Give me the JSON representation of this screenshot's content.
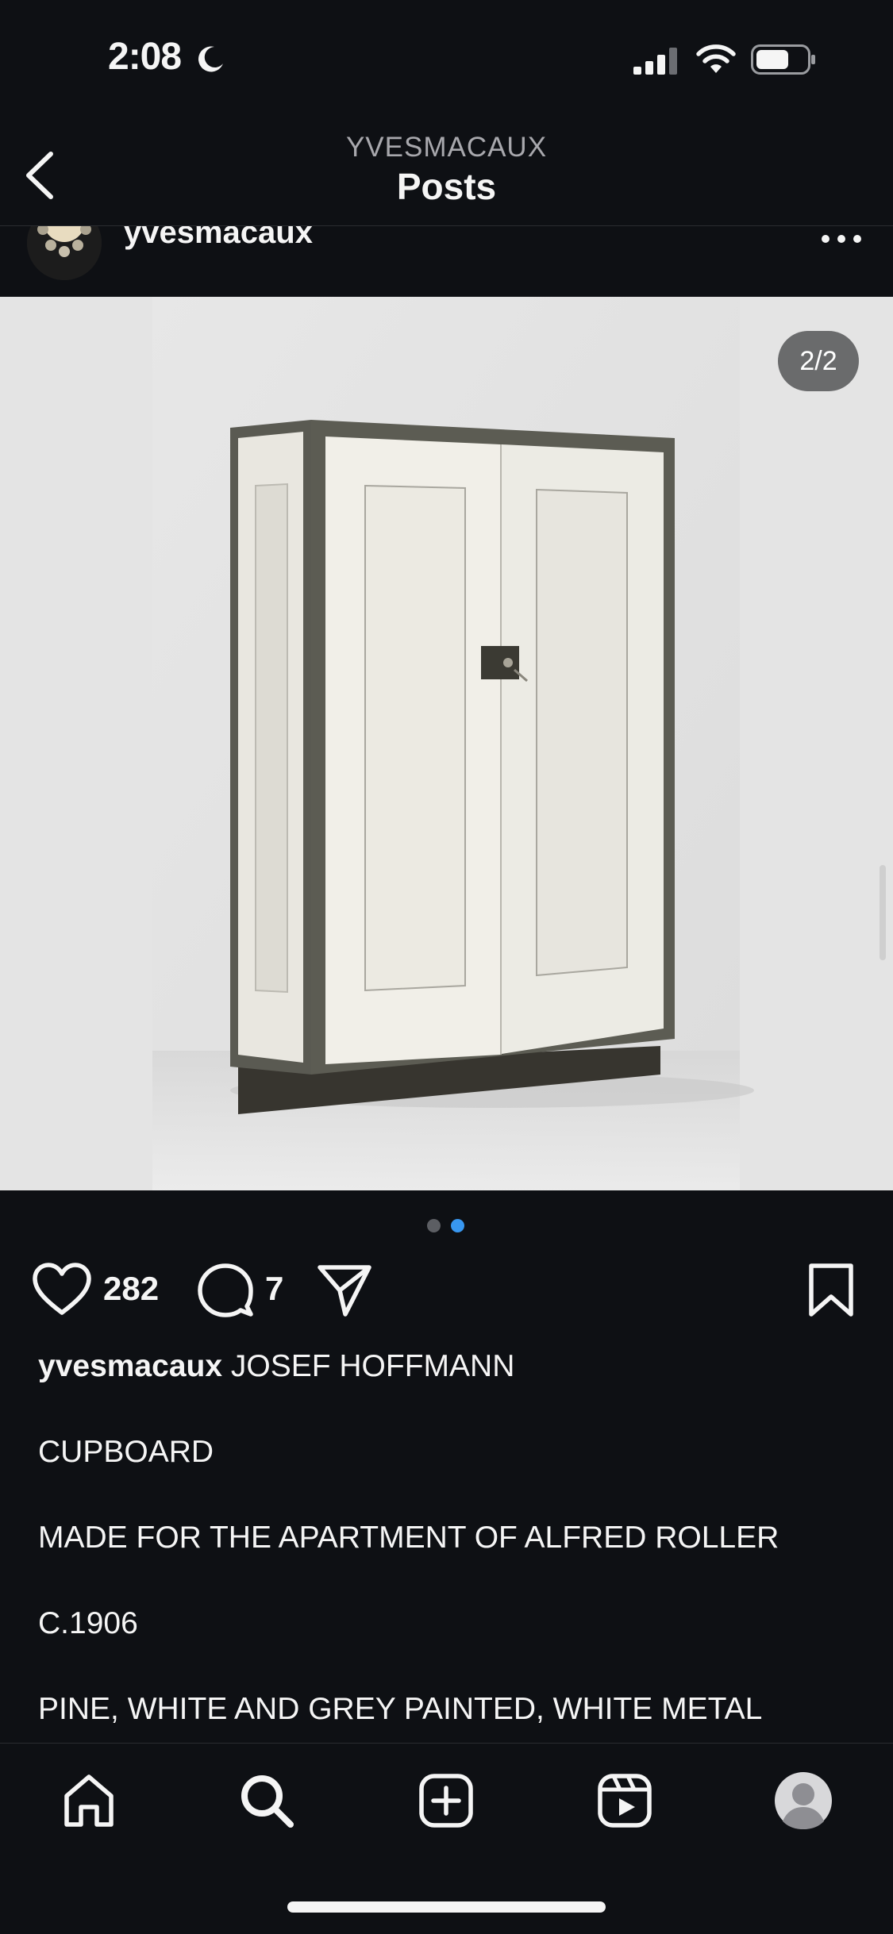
{
  "status_bar": {
    "time": "2:08",
    "icons": [
      "moon-icon",
      "cellular-signal-icon",
      "wifi-icon",
      "battery-icon"
    ]
  },
  "header": {
    "subtitle": "YVESMACAUX",
    "title": "Posts",
    "back_icon": "chevron-left-icon"
  },
  "post": {
    "username": "yvesmacaux",
    "more_icon": "ellipsis-icon",
    "media_counter": "2/2",
    "carousel": {
      "count": 2,
      "active": 2,
      "active_color": "#3897f0",
      "inactive_color": "#5c5e63"
    },
    "likes": "282",
    "comments": "7",
    "caption": {
      "username": "yvesmacaux",
      "lines": [
        "JOSEF HOFFMANN",
        "CUPBOARD",
        "MADE FOR THE APARTMENT OF ALFRED ROLLER",
        "C.1906",
        "PINE, WHITE AND GREY PAINTED, WHITE METAL"
      ]
    }
  },
  "tab_bar": {
    "items": [
      {
        "icon": "home-icon"
      },
      {
        "icon": "search-icon"
      },
      {
        "icon": "create-post-icon"
      },
      {
        "icon": "reels-icon"
      },
      {
        "icon": "profile-avatar"
      }
    ]
  },
  "colors": {
    "background": "#0e1014",
    "text": "#f5f5f5",
    "muted": "#a8a8ad",
    "accent": "#3897f0"
  }
}
